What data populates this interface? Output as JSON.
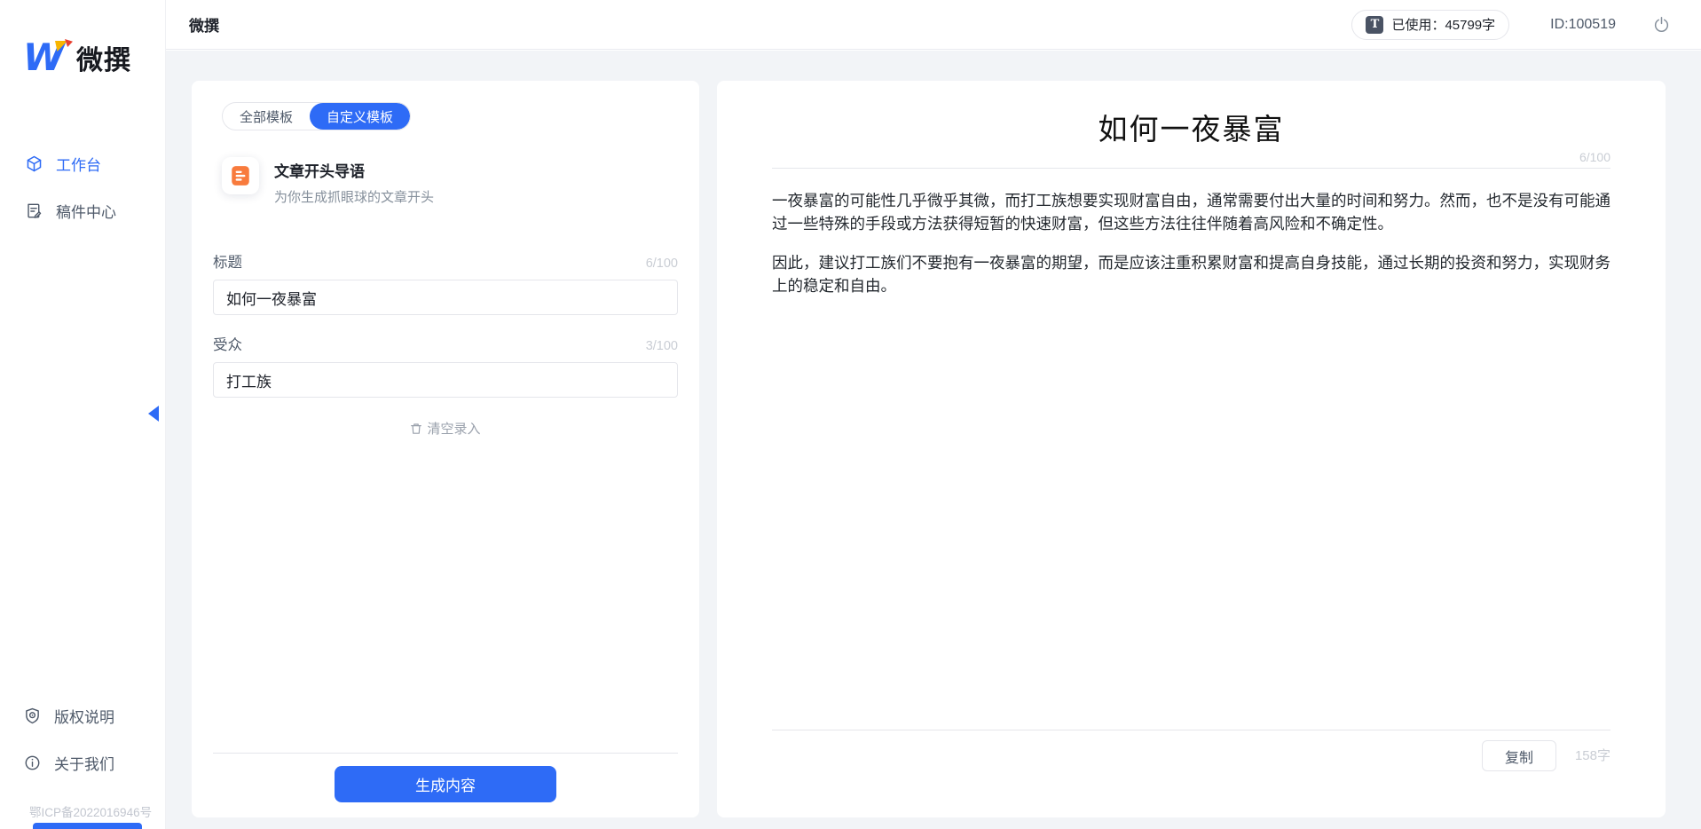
{
  "app": {
    "name": "微撰"
  },
  "topbar": {
    "title": "微撰",
    "usage_icon": "T",
    "usage_label": "已使用：45799字",
    "user_id": "ID:100519",
    "power_icon": "power-icon"
  },
  "sidebar": {
    "logo_w": "W",
    "logo_text": "微撰",
    "items": [
      {
        "label": "工作台",
        "icon": "workspace-cube-icon",
        "active": true
      },
      {
        "label": "稿件中心",
        "icon": "draft-document-icon",
        "active": false
      }
    ],
    "footer_items": [
      {
        "label": "版权说明",
        "icon": "copyright-shield-icon"
      },
      {
        "label": "关于我们",
        "icon": "info-circle-icon"
      }
    ],
    "icp": "鄂ICP备2022016946号"
  },
  "template_panel": {
    "tabs": [
      {
        "label": "全部模板",
        "active": false
      },
      {
        "label": "自定义模板",
        "active": true
      }
    ],
    "template": {
      "title": "文章开头导语",
      "desc": "为你生成抓眼球的文章开头",
      "icon": "orange-document-icon"
    },
    "fields": [
      {
        "label": "标题",
        "counter": "6/100",
        "value": "如何一夜暴富"
      },
      {
        "label": "受众",
        "counter": "3/100",
        "value": "打工族"
      }
    ],
    "clear_label": "清空录入",
    "generate_label": "生成内容"
  },
  "result_panel": {
    "title": "如何一夜暴富",
    "counter": "6/100",
    "paragraphs": [
      "一夜暴富的可能性几乎微乎其微，而打工族想要实现财富自由，通常需要付出大量的时间和努力。然而，也不是没有可能通过一些特殊的手段或方法获得短暂的快速财富，但这些方法往往伴随着高风险和不确定性。",
      "因此，建议打工族们不要抱有一夜暴富的期望，而是应该注重积累财富和提高自身技能，通过长期的投资和努力，实现财务上的稳定和自由。"
    ],
    "copy_label": "复制",
    "word_count": "158字"
  },
  "colors": {
    "accent": "#2e6bf6",
    "orange": "#f87b3d",
    "text1": "#1d2129",
    "text2": "#4e5969",
    "muted": "#86909c",
    "faint": "#c9cdd4",
    "border": "#e5e6eb",
    "bg": "#f2f4f7"
  }
}
